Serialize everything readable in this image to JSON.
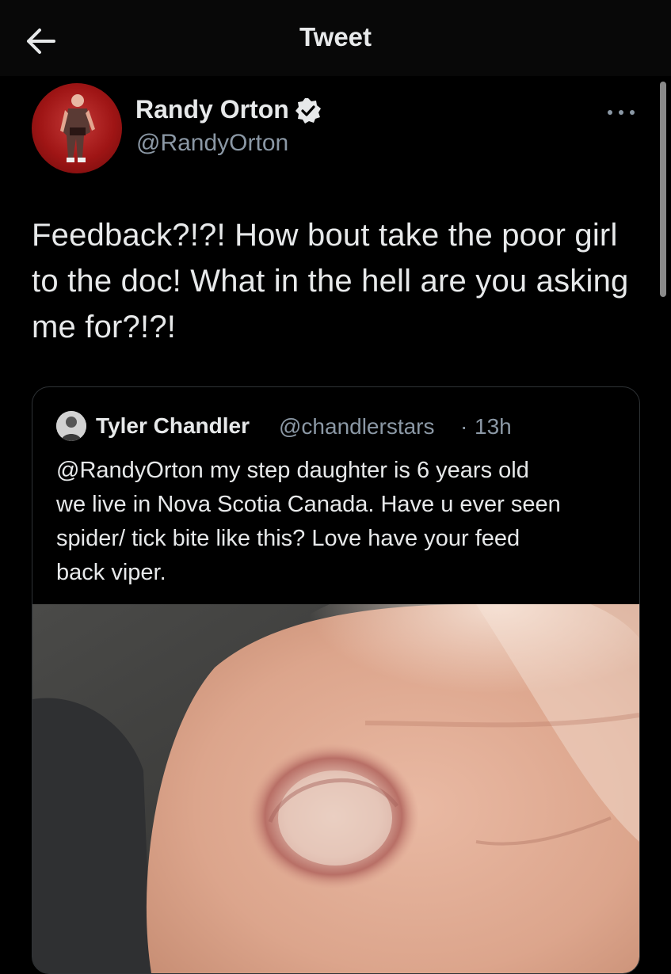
{
  "header": {
    "title": "Tweet",
    "back_icon": "arrow-left-icon"
  },
  "tweet": {
    "author_name": "Randy Orton",
    "author_handle": "@RandyOrton",
    "verified_icon": "verified-badge-icon",
    "more_icon": "more-dots-icon",
    "text": "Feedback?!?! How bout take the poor girl to the doc! What in the hell are you asking me for?!?!"
  },
  "quoted_tweet": {
    "author_name": "Tyler Chandler",
    "author_handle": "@chandlerstars",
    "separator": "·",
    "time": "13h",
    "text_lines": [
      "@RandyOrton my step daughter is 6 years old",
      "we live in Nova Scotia Canada. Have u ever seen",
      "spider/ tick bite like this? Love have your feed",
      "back viper."
    ]
  },
  "colors": {
    "background": "#000000",
    "text": "#e7e9ea",
    "secondary_text": "#8b98a5",
    "border": "#2f3336"
  }
}
